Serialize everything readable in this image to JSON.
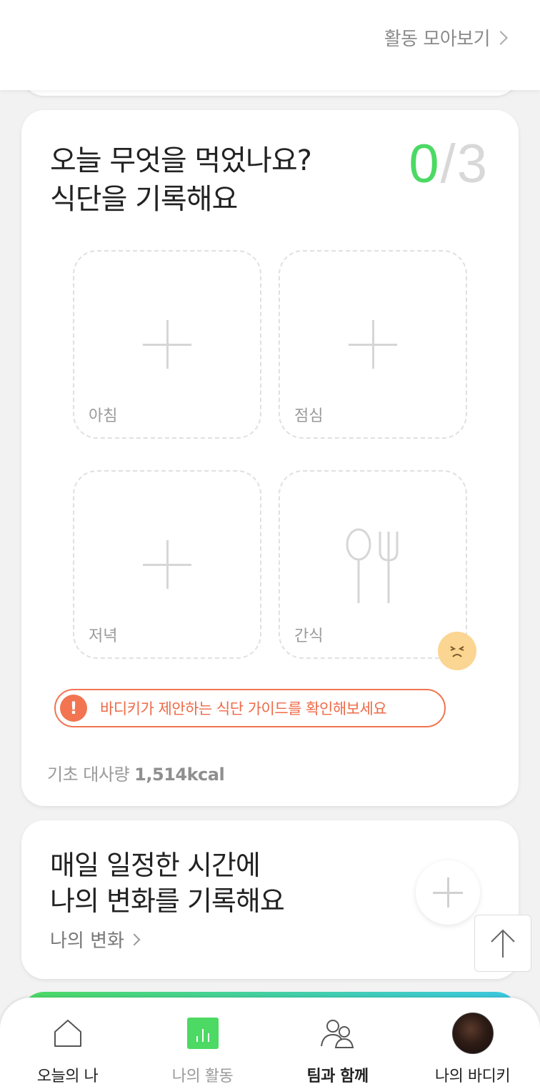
{
  "header": {
    "activity_link": "활동 모아보기"
  },
  "meal_card": {
    "title_line1": "오늘 무엇을 먹었나요?",
    "title_line2": "식단을 기록해요",
    "count_done": "0",
    "count_sep": "/",
    "count_total": "3",
    "slots": [
      {
        "label": "아침"
      },
      {
        "label": "점심"
      },
      {
        "label": "저녁"
      },
      {
        "label": "간식"
      }
    ],
    "guide_text": "바디키가 제안하는 식단 가이드를 확인해보세요",
    "bmr_label": "기초 대사량",
    "bmr_value": "1,514kcal"
  },
  "change_card": {
    "title_line1": "매일 일정한 시간에",
    "title_line2": "나의 변화를 기록해요",
    "link": "나의 변화"
  },
  "bottom_nav": {
    "items": [
      {
        "label": "오늘의 나",
        "icon": "home-icon"
      },
      {
        "label": "나의 활동",
        "icon": "activity-chart-icon"
      },
      {
        "label": "팀과 함께",
        "icon": "team-icon"
      },
      {
        "label": "나의 바디키",
        "icon": "avatar"
      }
    ]
  },
  "colors": {
    "accent_green": "#4cd964",
    "warning_orange": "#f27451",
    "sad_face": "#fbd592"
  }
}
